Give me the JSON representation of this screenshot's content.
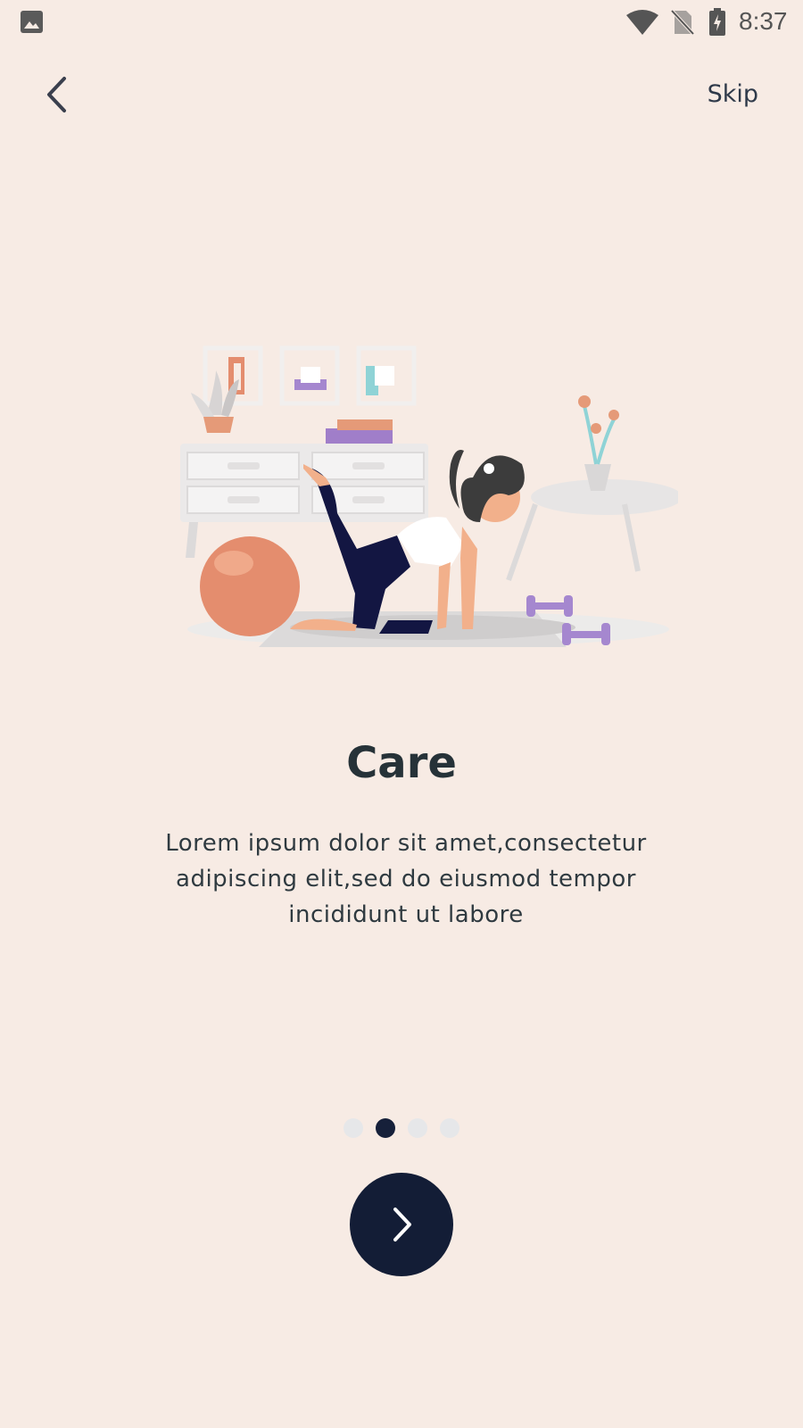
{
  "status_bar": {
    "time": "8:37",
    "icons": [
      "image-notification-icon",
      "wifi-icon",
      "no-sim-icon",
      "battery-charging-icon"
    ]
  },
  "header": {
    "back_icon": "chevron-left-icon",
    "skip_label": "Skip"
  },
  "illustration": {
    "subject": "woman-exercising-illustration"
  },
  "content": {
    "title": "Care",
    "description": "Lorem ipsum dolor sit amet,consectetur adipiscing elit,sed do eiusmod tempor incididunt ut labore"
  },
  "pager": {
    "total": 4,
    "active_index": 1
  },
  "next_button": {
    "icon": "chevron-right-icon"
  },
  "colors": {
    "background": "#f7ebe4",
    "accent_dark": "#131d36",
    "dot_inactive": "#e6e7e9",
    "title_text": "#263238"
  }
}
